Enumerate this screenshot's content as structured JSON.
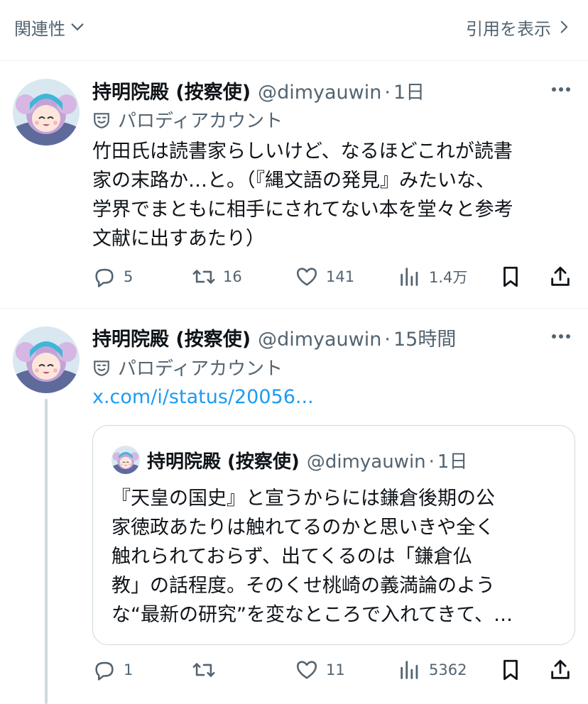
{
  "header": {
    "sort_label": "関連性",
    "quotes_label": "引用を表示"
  },
  "posts": [
    {
      "name": "持明院殿 (按察使)",
      "handle": "@dimyauwin",
      "time": "1日",
      "label": "パロディアカウント",
      "lines": [
        "竹田氏は読書家らしいけど、なるほどこれが読書",
        "家の末路か…と。（『縄文語の発見』みたいな、",
        "学界でまともに相手にされてない本を堂々と参考",
        "文献に出すあたり）"
      ],
      "replies": "5",
      "reposts": "16",
      "likes": "141",
      "views": "1.4万"
    },
    {
      "name": "持明院殿 (按察使)",
      "handle": "@dimyauwin",
      "time": "15時間",
      "label": "パロディアカウント",
      "link": "x.com/i/status/20056...",
      "quote": {
        "name": "持明院殿 (按察使)",
        "handle": "@dimyauwin",
        "time": "1日",
        "lines": [
          "『天皇の国史』と宣うからには鎌倉後期の公",
          "家徳政あたりは触れてるのかと思いきや全く",
          "触れられておらず、出てくるのは「鎌倉仏",
          "教」の話程度。そのくせ桃崎の義満論のよう",
          "な“最新の研究”を変なところで入れてきて、…"
        ]
      },
      "replies": "1",
      "reposts": "",
      "likes": "11",
      "views": "5362"
    }
  ],
  "colors": {
    "text": "#0f1419",
    "secondary": "#536471",
    "link": "#1d9bf0",
    "border": "#eff3f4"
  },
  "icons": [
    "chevron-down-icon",
    "chevron-right-icon",
    "more-icon",
    "parody-mask-icon",
    "reply-icon",
    "repost-icon",
    "like-icon",
    "views-icon",
    "bookmark-icon",
    "share-icon"
  ]
}
